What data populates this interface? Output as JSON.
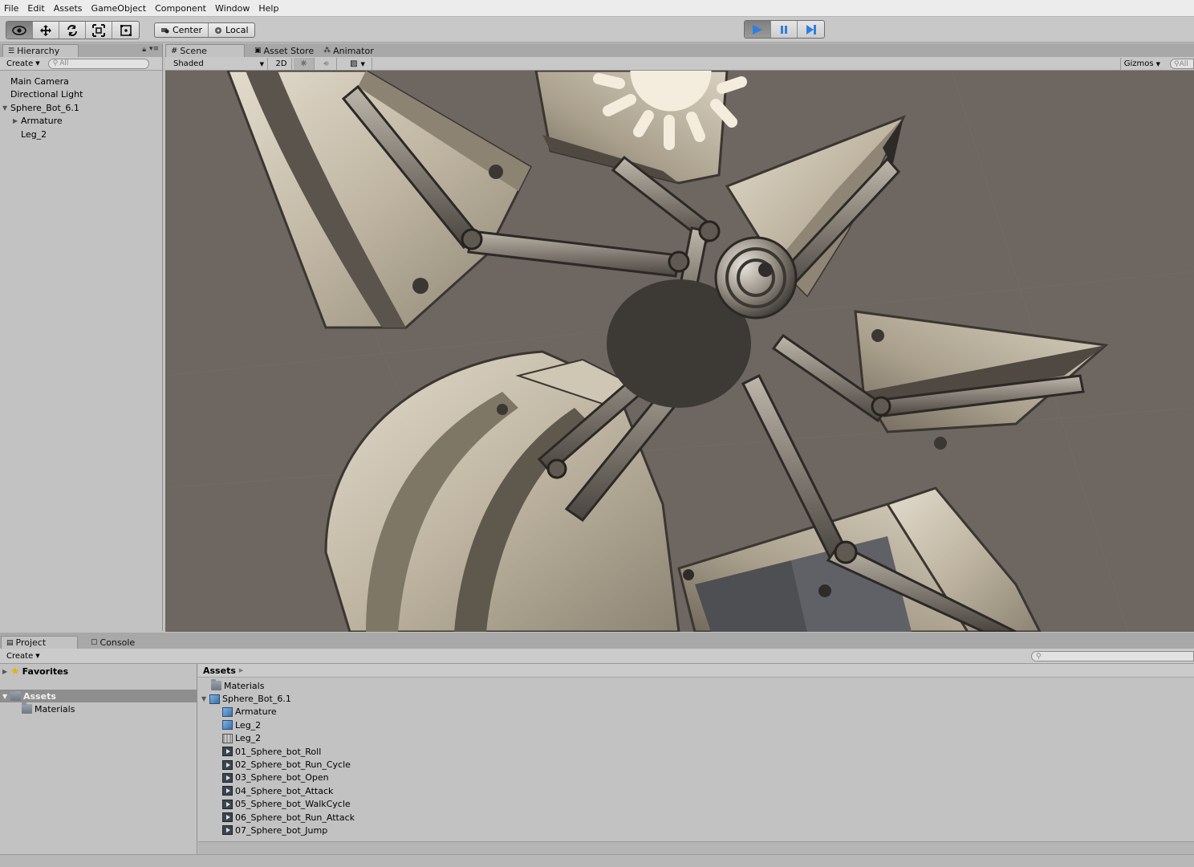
{
  "menu": [
    "File",
    "Edit",
    "Assets",
    "GameObject",
    "Component",
    "Window",
    "Help"
  ],
  "toolbar": {
    "tools": [
      "hand-eye-icon",
      "move-icon",
      "rotate-icon",
      "scale-icon",
      "rect-icon"
    ],
    "pivot": "Center",
    "space": "Local",
    "play_icons": [
      "play-icon",
      "pause-icon",
      "step-icon"
    ]
  },
  "hierarchy": {
    "tab": "Hierarchy",
    "create": "Create",
    "search_placeholder": "All",
    "items": [
      {
        "label": "Main Camera",
        "indent": 0,
        "arrow": ""
      },
      {
        "label": "Directional Light",
        "indent": 0,
        "arrow": ""
      },
      {
        "label": "Sphere_Bot_6.1",
        "indent": 0,
        "arrow": "open"
      },
      {
        "label": "Armature",
        "indent": 1,
        "arrow": "closed"
      },
      {
        "label": "Leg_2",
        "indent": 1,
        "arrow": ""
      }
    ]
  },
  "scene": {
    "tabs": [
      "Scene",
      "Asset Store",
      "Animator"
    ],
    "shading": "Shaded",
    "mode_2d": "2D",
    "gizmos": "Gizmos",
    "search_placeholder": "All"
  },
  "project": {
    "tabs": [
      "Project",
      "Console"
    ],
    "create": "Create",
    "left": {
      "favorites": "Favorites",
      "assets": "Assets",
      "materials": "Materials"
    },
    "breadcrumb": "Assets",
    "assets": [
      {
        "label": "Materials",
        "type": "folder",
        "indent": 0
      },
      {
        "label": "Sphere_Bot_6.1",
        "type": "model",
        "indent": 0
      },
      {
        "label": "Armature",
        "type": "prefab",
        "indent": 1
      },
      {
        "label": "Leg_2",
        "type": "prefab",
        "indent": 1
      },
      {
        "label": "Leg_2",
        "type": "mesh",
        "indent": 1
      },
      {
        "label": "01_Sphere_bot_Roll",
        "type": "anim",
        "indent": 1
      },
      {
        "label": "02_Sphere_bot_Run_Cycle",
        "type": "anim",
        "indent": 1
      },
      {
        "label": "03_Sphere_bot_Open",
        "type": "anim",
        "indent": 1
      },
      {
        "label": "04_Sphere_bot_Attack",
        "type": "anim",
        "indent": 1
      },
      {
        "label": "05_Sphere_bot_WalkCycle",
        "type": "anim",
        "indent": 1
      },
      {
        "label": "06_Sphere_bot_Run_Attack",
        "type": "anim",
        "indent": 1
      },
      {
        "label": "07_Sphere_bot_Jump",
        "type": "anim",
        "indent": 1
      }
    ]
  },
  "colors": {
    "viewport_bg": "#6d6661",
    "wood": "#cfc6b4",
    "metal": "#4a4744",
    "play_blue": "#2f7fe0"
  }
}
